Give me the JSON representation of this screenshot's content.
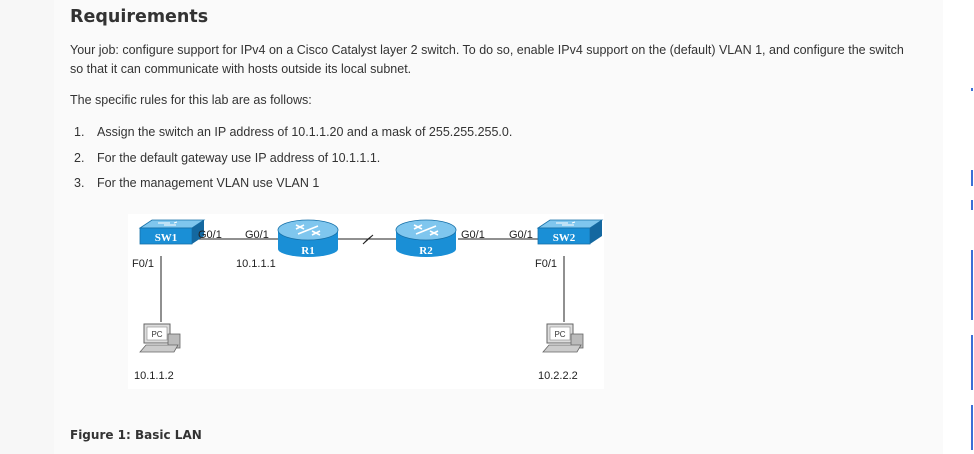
{
  "heading": "Requirements",
  "intro": "Your job: configure support for IPv4 on a Cisco Catalyst layer 2 switch. To do so, enable IPv4 support on the (default) VLAN 1, and configure the switch so that it can communicate with hosts outside its local subnet.",
  "rules_intro": "The specific rules for this lab are as follows:",
  "rules": [
    {
      "num": "1.",
      "text": "Assign the switch an IP address of 10.1.1.20 and a mask of 255.255.255.0."
    },
    {
      "num": "2.",
      "text": "For the default gateway use IP address of 10.1.1.1."
    },
    {
      "num": "3.",
      "text": "For the management VLAN use VLAN 1"
    }
  ],
  "diagram": {
    "sw1": {
      "name": "SW1",
      "port_up": "G0/1",
      "port_down": "F0/1"
    },
    "r1": {
      "name": "R1",
      "port": "G0/1",
      "ip": "10.1.1.1"
    },
    "r2": {
      "name": "R2",
      "port": "G0/1"
    },
    "sw2": {
      "name": "SW2",
      "port_up": "G0/1",
      "port_down": "F0/1"
    },
    "pc1": {
      "label": "PC",
      "ip": "10.1.1.2"
    },
    "pc2": {
      "label": "PC",
      "ip": "10.2.2.2"
    },
    "colors": {
      "device_blue": "#1a8fd6",
      "device_top": "#7fc6ee"
    }
  },
  "caption": "Figure 1: Basic LAN"
}
